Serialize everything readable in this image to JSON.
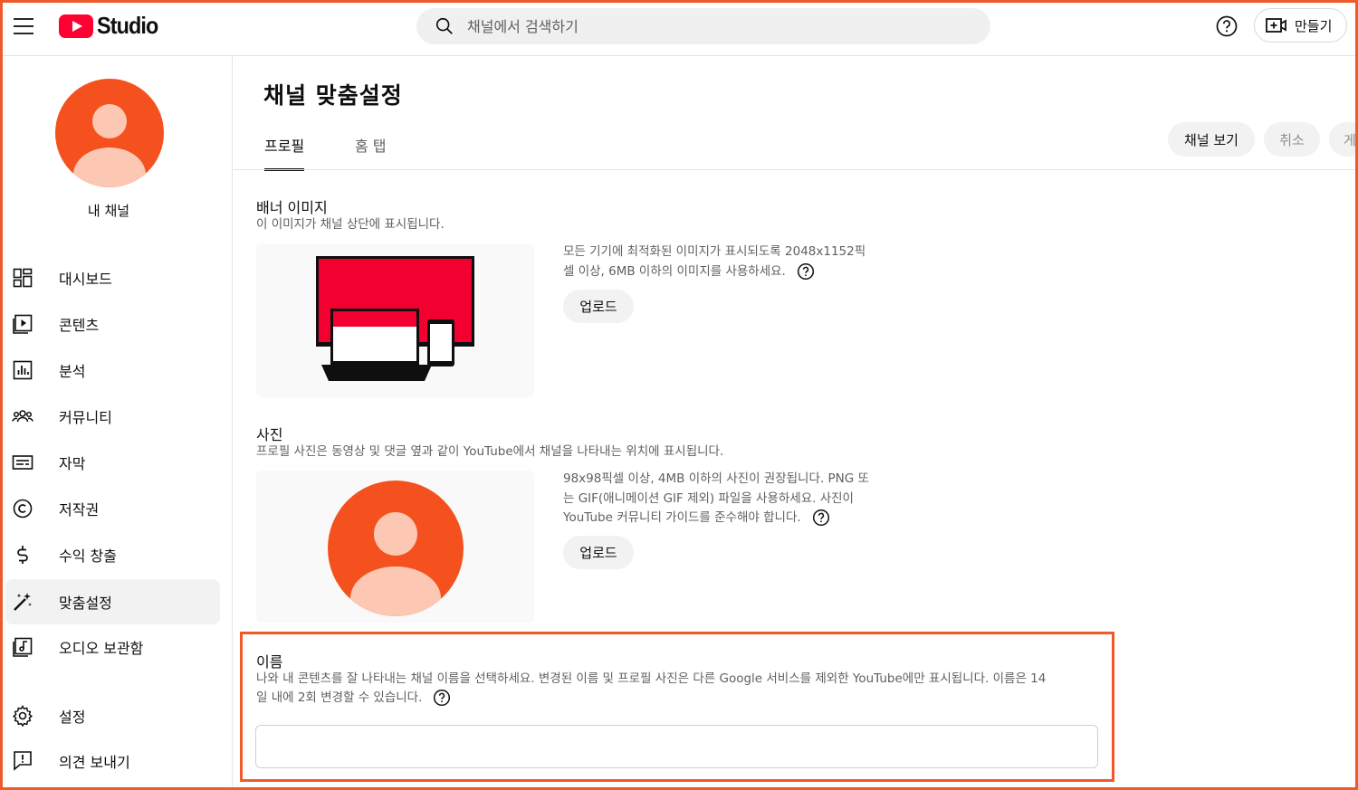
{
  "header": {
    "logo_text": "Studio",
    "search_placeholder": "채널에서 검색하기",
    "create_label": "만들기",
    "brand_color": "#ff0033"
  },
  "sidebar": {
    "channel_name": "내 채널",
    "avatar_color": "#f4511e",
    "items": [
      {
        "label": "대시보드",
        "icon": "dashboard-icon",
        "active": false
      },
      {
        "label": "콘텐츠",
        "icon": "content-icon",
        "active": false
      },
      {
        "label": "분석",
        "icon": "analytics-icon",
        "active": false
      },
      {
        "label": "커뮤니티",
        "icon": "community-icon",
        "active": false
      },
      {
        "label": "자막",
        "icon": "subtitles-icon",
        "active": false
      },
      {
        "label": "저작권",
        "icon": "copyright-icon",
        "active": false
      },
      {
        "label": "수익 창출",
        "icon": "monetization-icon",
        "active": false
      },
      {
        "label": "맞춤설정",
        "icon": "customization-icon",
        "active": true
      },
      {
        "label": "오디오 보관함",
        "icon": "audio-library-icon",
        "active": false
      }
    ],
    "bottom_items": [
      {
        "label": "설정",
        "icon": "settings-icon"
      },
      {
        "label": "의견 보내기",
        "icon": "feedback-icon"
      }
    ]
  },
  "main": {
    "title": "채널 맞춤설정",
    "tabs": [
      {
        "label": "프로필",
        "active": true
      },
      {
        "label": "홈 탭",
        "active": false
      }
    ],
    "actions": {
      "view_channel": "채널 보기",
      "cancel": "취소",
      "publish_partial": "게"
    },
    "banner": {
      "title": "배너 이미지",
      "description": "이 이미지가 채널 상단에 표시됩니다.",
      "info_line1": "모든 기기에 최적화된 이미지가 표시되도록 2048x1152픽",
      "info_line2": "셀 이상, 6MB 이하의 이미지를 사용하세요.",
      "upload_label": "업로드"
    },
    "photo": {
      "title": "사진",
      "description": "프로필 사진은 동영상 및 댓글 옆과 같이 YouTube에서 채널을 나타내는 위치에 표시됩니다.",
      "info_line1": "98x98픽셀 이상, 4MB 이하의 사진이 권장됩니다. PNG 또",
      "info_line2": "는 GIF(애니메이션 GIF 제외) 파일을 사용하세요. 사진이",
      "info_line3": "YouTube 커뮤니티 가이드를 준수해야 합니다.",
      "upload_label": "업로드"
    },
    "name": {
      "title": "이름",
      "description_line1": "나와 내 콘텐츠를 잘 나타내는 채널 이름을 선택하세요. 변경된 이름 및 프로필 사진은 다른 Google 서비스를 제외한 YouTube에만 표시됩니다. 이름은 14",
      "description_line2": "일 내에 2회 변경할 수 있습니다.",
      "value": "",
      "highlight_color": "#ef5a2a"
    }
  }
}
